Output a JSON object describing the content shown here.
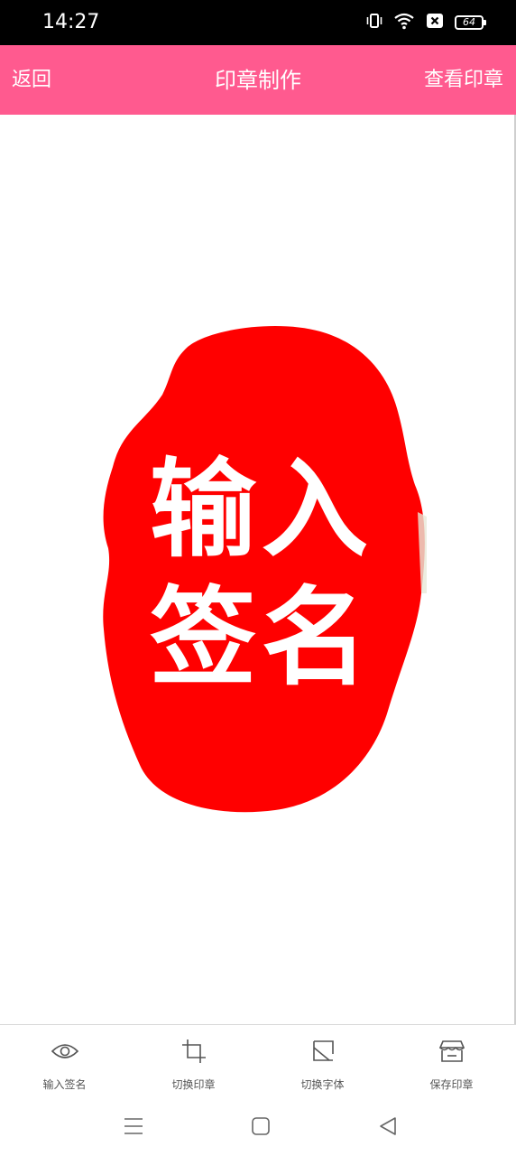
{
  "status_bar": {
    "time": "14:27",
    "battery": "64"
  },
  "app_bar": {
    "back_label": "返回",
    "title": "印章制作",
    "view_label": "查看印章"
  },
  "seal": {
    "line1": "输入",
    "line2": "签名",
    "color": "#ff0000"
  },
  "toolbar": {
    "items": [
      {
        "label": "输入签名",
        "icon": "eye-icon"
      },
      {
        "label": "切换印章",
        "icon": "crop-icon"
      },
      {
        "label": "切换字体",
        "icon": "font-switch-icon"
      },
      {
        "label": "保存印章",
        "icon": "store-icon"
      }
    ]
  },
  "nav": {
    "items": [
      "menu-icon",
      "home-icon",
      "back-triangle-icon"
    ]
  },
  "colors": {
    "app_bar": "#ff5a8f",
    "status_bar": "#000000"
  }
}
